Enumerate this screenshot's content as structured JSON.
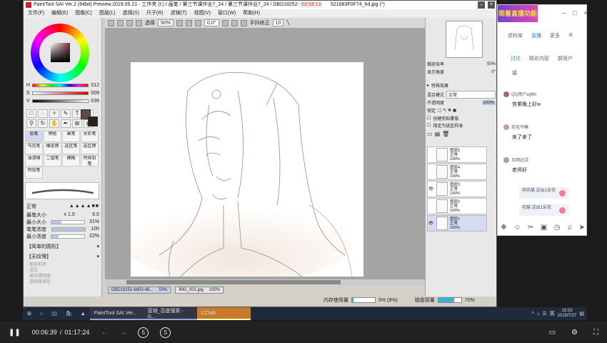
{
  "sai": {
    "title": "PaintTool SAI Ver.2 (64bit) Preview.2019.05.21 - 工作夹 (I:) / 画笔 / 第三节课作业7_24 / 第三节课作业7_24 / DBD18252-66",
    "title_tail": "521683F0F74_hd.jpg (*)",
    "menu": [
      "文件(F)",
      "编辑(E)",
      "图像(C)",
      "图层(L)",
      "选择(S)",
      "尺子(R)",
      "滤镜(T)",
      "视图(V)",
      "窗口(W)",
      "帮助(H)"
    ],
    "toolbar": {
      "select_label": "选择",
      "zoom": "50%",
      "angle": "0.0°",
      "stabilizer_label": "手抖修正",
      "stabilizer_value": "10"
    },
    "hsv": [
      {
        "label": "H",
        "value": "012"
      },
      {
        "label": "S",
        "value": "009"
      },
      {
        "label": "V",
        "value": "036"
      }
    ],
    "brushes": [
      "铅笔",
      "喷枪",
      "画笔",
      "水彩笔",
      "马克笔",
      "橡皮擦",
      "选区笔",
      "选区擦",
      "油漆桶",
      "二值笔",
      "模糊",
      "特殊铅笔",
      "特效笔"
    ],
    "brush_props": {
      "blend": "正常",
      "size_label": "最笔大小",
      "size_mult": "x 1.0",
      "size_value": "6.0",
      "min_size_label": "最小大小",
      "min_size_value": "31%",
      "min_size_pct": 31,
      "density_label": "笔笔浓度",
      "density_value": "100",
      "min_density_label": "最小浓度",
      "min_density_value": "22%",
      "shape_label": "【简单的圆形】",
      "texture_label": "【无纹理】",
      "opt1": "笔刷形状",
      "opt2": "混合",
      "opt3": "保持透明度",
      "opt4": "透明度锁定"
    },
    "right": {
      "zoom_label": "缩放倍率",
      "zoom_value": "50%",
      "angle_label": "显示角度",
      "angle_value": "0°",
      "effect_label": "特殊效果",
      "blend_label": "混合模式",
      "blend_value": "正常",
      "opacity_label": "不透明度",
      "opacity_value": "100%",
      "lock_label": "锁定",
      "clip_label": "创建剪贴蒙版",
      "sample_label": "指定为选区样本",
      "layers": [
        {
          "name": "图层5",
          "mode": "正常",
          "opacity": "100%",
          "visible": false,
          "selected": false
        },
        {
          "name": "图层4",
          "mode": "正常",
          "opacity": "100%",
          "visible": false,
          "selected": false
        },
        {
          "name": "图层3",
          "mode": "正常",
          "opacity": "100%",
          "visible": true,
          "selected": false
        },
        {
          "name": "图层2",
          "mode": "正常",
          "opacity": "100%",
          "visible": false,
          "selected": false
        },
        {
          "name": "图层1",
          "mode": "正常",
          "opacity": "100%",
          "visible": true,
          "selected": true
        }
      ]
    },
    "doc_tabs": [
      {
        "name": "DBD18252-6603-48...",
        "zoom": "50%"
      },
      {
        "name": "IMG_001.jpg",
        "zoom": "100%"
      }
    ],
    "status": {
      "mem_label": "内存使用量",
      "mem_value": "5% (9%)",
      "mem_pct": 5,
      "disk_label": "磁盘容量",
      "disk_value": "70%",
      "disk_pct": 70
    },
    "timer": "03:53:13"
  },
  "cc": {
    "banner": "观看直播功能",
    "tabs": [
      "资料库",
      "直播",
      "更多"
    ],
    "subtabs": [
      "讨论",
      "精彩内容",
      "群用户"
    ],
    "messages": [
      {
        "user": "",
        "text": "谈"
      },
      {
        "user": "QQ用户wj9th",
        "text": "劳累晚上好w"
      },
      {
        "user": "花毛不睡",
        "text": "来了来了"
      },
      {
        "user": "五明远试",
        "text": "老师好"
      }
    ],
    "gifts": [
      "明花猫 送出1朵花",
      "花猫 送出1朵花"
    ]
  },
  "taskbar": {
    "apps": [
      "PaintTool SAI Ver...",
      "营销_百度搜索 - G...",
      "CCtalk"
    ],
    "ime": "英",
    "time": "19:53",
    "date": "2019/7/27"
  },
  "player": {
    "current": "00:06:39",
    "total": "01:17:24",
    "skip_back": "5",
    "skip_fwd": "5"
  }
}
